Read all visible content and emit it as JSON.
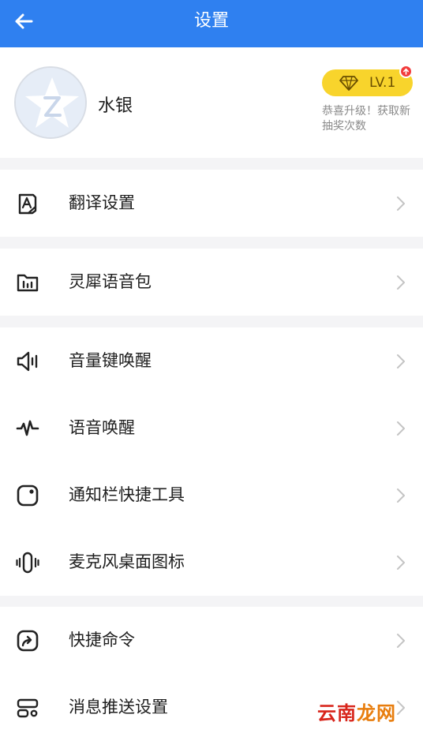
{
  "header": {
    "title": "设置",
    "back_icon": "arrow-left-icon",
    "background": "#2f80f0"
  },
  "profile": {
    "username": "水银",
    "level_label": "LV.1",
    "level_hint": "恭喜升级！获取新抽奖次数",
    "badge_color": "#f8d42c",
    "badge_icon": "diamond-icon",
    "notification_icon": "arrow-up-icon"
  },
  "groups": [
    {
      "items": [
        {
          "label": "翻译设置",
          "icon": "translate-settings-icon"
        }
      ]
    },
    {
      "items": [
        {
          "label": "灵犀语音包",
          "icon": "voice-pack-folder-icon"
        }
      ]
    },
    {
      "items": [
        {
          "label": "音量键唤醒",
          "icon": "speaker-icon"
        },
        {
          "label": "语音唤醒",
          "icon": "waveform-icon"
        },
        {
          "label": "通知栏快捷工具",
          "icon": "notification-bar-icon"
        },
        {
          "label": "麦克风桌面图标",
          "icon": "microphone-icon"
        }
      ]
    },
    {
      "items": [
        {
          "label": "快捷命令",
          "icon": "shortcut-command-icon"
        },
        {
          "label": "消息推送设置",
          "icon": "push-settings-icon"
        }
      ]
    }
  ],
  "watermark": {
    "part1": "云南",
    "part2": "龙网"
  }
}
